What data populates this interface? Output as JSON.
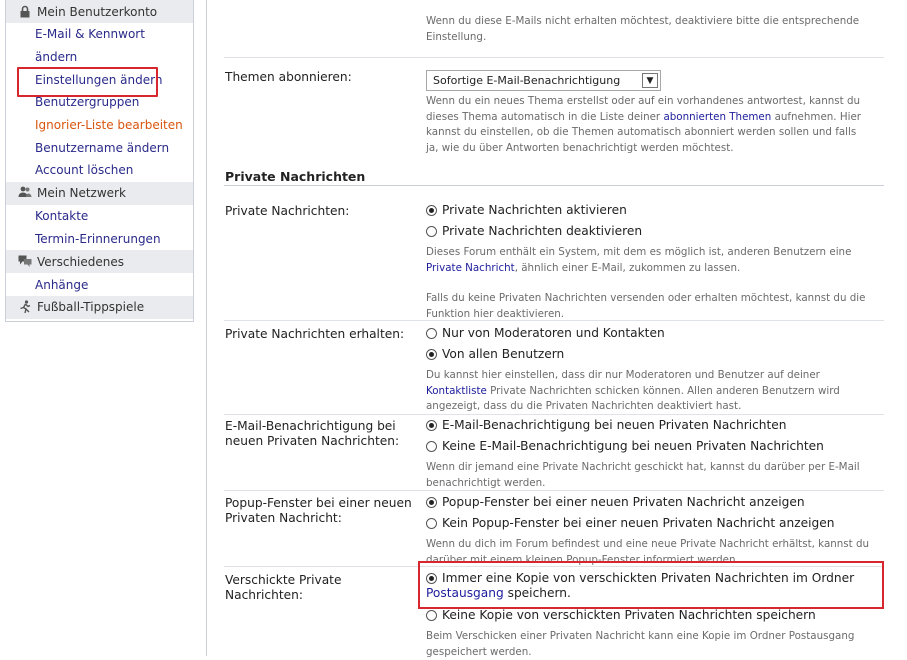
{
  "sidebar": {
    "sections": [
      {
        "title": "Mein Benutzerkonto",
        "icon": "lock-icon"
      },
      {
        "title": "Mein Netzwerk",
        "icon": "users-icon"
      },
      {
        "title": "Verschiedenes",
        "icon": "chat-icon"
      },
      {
        "title": "Fußball-Tippspiele",
        "icon": "runner-icon"
      }
    ],
    "konto_items": [
      "E-Mail & Kennwort",
      "ändern",
      "Einstellungen ändern",
      "Benutzergruppen",
      "Ignorier-Liste bearbeiten",
      "Benutzername ändern",
      "Account löschen"
    ],
    "netzwerk_items": [
      "Kontakte",
      "Termin-Erinnerungen"
    ],
    "verschiedenes_items": [
      "Anhänge"
    ]
  },
  "top_note": [
    "Wenn du diese E-Mails nicht erhalten möchtest, deaktiviere bitte die entsprechende",
    "Einstellung."
  ],
  "themen": {
    "label": "Themen abonnieren:",
    "selected": "Sofortige E-Mail-Benachrichtigung",
    "desc1": "Wenn du ein neues Thema erstellst oder auf ein vorhandenes antwortest, kannst du",
    "desc2a": "dieses Thema automatisch in die Liste deiner ",
    "desc2link": "abonnierten Themen",
    "desc2b": " aufnehmen. Hier",
    "desc3": "kannst du einstellen, ob die Themen automatisch abonniert werden sollen und falls",
    "desc4": "ja, wie du über Antworten benachrichtigt werden möchtest."
  },
  "pm": {
    "section_title": "Private Nachrichten",
    "enable": {
      "label": "Private Nachrichten:",
      "opt1": "Private Nachrichten aktivieren",
      "opt2": "Private Nachrichten deaktivieren",
      "desc1": "Dieses Forum enthält ein System, mit dem es möglich ist, anderen Benutzern eine",
      "desc2link": "Private Nachricht",
      "desc2b": ", ähnlich einer E-Mail, zukommen zu lassen.",
      "desc3": "Falls du keine Privaten Nachrichten versenden oder erhalten möchtest, kannst du die",
      "desc4": "Funktion hier deaktivieren."
    },
    "receive": {
      "label": "Private Nachrichten erhalten:",
      "opt1": "Nur von Moderatoren und Kontakten",
      "opt2": "Von allen Benutzern",
      "desc1": "Du kannst hier einstellen, dass dir nur Moderatoren und Benutzer auf deiner",
      "desc2link": "Kontaktliste",
      "desc2b": " Private Nachrichten schicken können. Allen anderen Benutzern wird",
      "desc3": "angezeigt, dass du die Privaten Nachrichten deaktiviert hast."
    },
    "email": {
      "label1": "E-Mail-Benachrichtigung bei",
      "label2": "neuen Privaten Nachrichten:",
      "opt1": "E-Mail-Benachrichtigung bei neuen Privaten Nachrichten",
      "opt2": "Keine E-Mail-Benachrichtigung bei neuen Privaten Nachrichten",
      "desc1": "Wenn dir jemand eine Private Nachricht geschickt hat, kannst du darüber per E-Mail",
      "desc2": "benachrichtigt werden."
    },
    "popup": {
      "label1": "Popup-Fenster bei einer neuen",
      "label2": "Privaten Nachricht:",
      "opt1": "Popup-Fenster bei einer neuen Privaten Nachricht anzeigen",
      "opt2": "Kein Popup-Fenster bei einer neuen Privaten Nachricht anzeigen",
      "desc1": "Wenn du dich im Forum befindest und eine neue Private Nachricht erhältst, kannst du",
      "desc2": "darüber mit einem kleinen Popup-Fenster informiert werden."
    },
    "copy": {
      "label1": "Verschickte Private",
      "label2": "Nachrichten:",
      "opt1a": "Immer eine Kopie von verschickten Privaten Nachrichten im Ordner",
      "opt1link": "Postausgang",
      "opt1b": " speichern.",
      "opt2": "Keine Kopie von verschickten Privaten Nachrichten speichern",
      "desc1": "Beim Verschicken einer Privaten Nachricht kann eine Kopie im Ordner Postausgang",
      "desc2": "gespeichert werden."
    }
  },
  "colors": {
    "highlight": "#d7262e",
    "link": "#1d1d9d",
    "accent_orange": "#d9550f"
  }
}
